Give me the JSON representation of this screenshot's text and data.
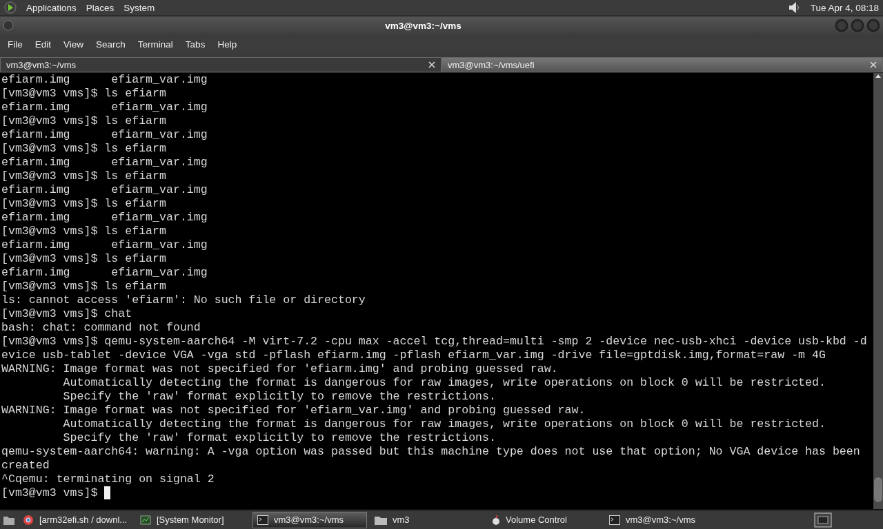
{
  "top_panel": {
    "menus": [
      "Applications",
      "Places",
      "System"
    ],
    "clock": "Tue Apr  4, 08:18"
  },
  "window": {
    "title": "vm3@vm3:~/vms"
  },
  "menubar": [
    "File",
    "Edit",
    "View",
    "Search",
    "Terminal",
    "Tabs",
    "Help"
  ],
  "tabs": [
    {
      "label": "vm3@vm3:~/vms",
      "selected": true
    },
    {
      "label": "vm3@vm3:~/vms/uefi",
      "selected": false
    }
  ],
  "terminal": {
    "cursor": true,
    "lines": [
      "efiarm.img      efiarm_var.img",
      "[vm3@vm3 vms]$ ls efiarm",
      "efiarm.img      efiarm_var.img",
      "[vm3@vm3 vms]$ ls efiarm",
      "efiarm.img      efiarm_var.img",
      "[vm3@vm3 vms]$ ls efiarm",
      "efiarm.img      efiarm_var.img",
      "[vm3@vm3 vms]$ ls efiarm",
      "efiarm.img      efiarm_var.img",
      "[vm3@vm3 vms]$ ls efiarm",
      "efiarm.img      efiarm_var.img",
      "[vm3@vm3 vms]$ ls efiarm",
      "efiarm.img      efiarm_var.img",
      "[vm3@vm3 vms]$ ls efiarm",
      "efiarm.img      efiarm_var.img",
      "[vm3@vm3 vms]$ ls efiarm",
      "ls: cannot access 'efiarm': No such file or directory",
      "[vm3@vm3 vms]$ chat",
      "bash: chat: command not found",
      "[vm3@vm3 vms]$ qemu-system-aarch64 -M virt-7.2 -cpu max -accel tcg,thread=multi -smp 2 -device nec-usb-xhci -device usb-kbd -d",
      "evice usb-tablet -device VGA -vga std -pflash efiarm.img -pflash efiarm_var.img -drive file=gptdisk.img,format=raw -m 4G",
      "WARNING: Image format was not specified for 'efiarm.img' and probing guessed raw.",
      "         Automatically detecting the format is dangerous for raw images, write operations on block 0 will be restricted.",
      "         Specify the 'raw' format explicitly to remove the restrictions.",
      "WARNING: Image format was not specified for 'efiarm_var.img' and probing guessed raw.",
      "         Automatically detecting the format is dangerous for raw images, write operations on block 0 will be restricted.",
      "         Specify the 'raw' format explicitly to remove the restrictions.",
      "qemu-system-aarch64: warning: A -vga option was passed but this machine type does not use that option; No VGA device has been",
      "created",
      "^Cqemu: terminating on signal 2",
      "[vm3@vm3 vms]$ "
    ]
  },
  "taskbar": [
    {
      "kind": "browser",
      "label": "[arm32efi.sh / downl...",
      "selected": false
    },
    {
      "kind": "monitor",
      "label": "[System Monitor]",
      "selected": false
    },
    {
      "kind": "terminal",
      "label": "vm3@vm3:~/vms",
      "selected": true
    },
    {
      "kind": "folder",
      "label": "vm3",
      "selected": false
    },
    {
      "kind": "volume",
      "label": "Volume Control",
      "selected": false
    },
    {
      "kind": "terminal",
      "label": "vm3@vm3:~/vms",
      "selected": false
    }
  ]
}
